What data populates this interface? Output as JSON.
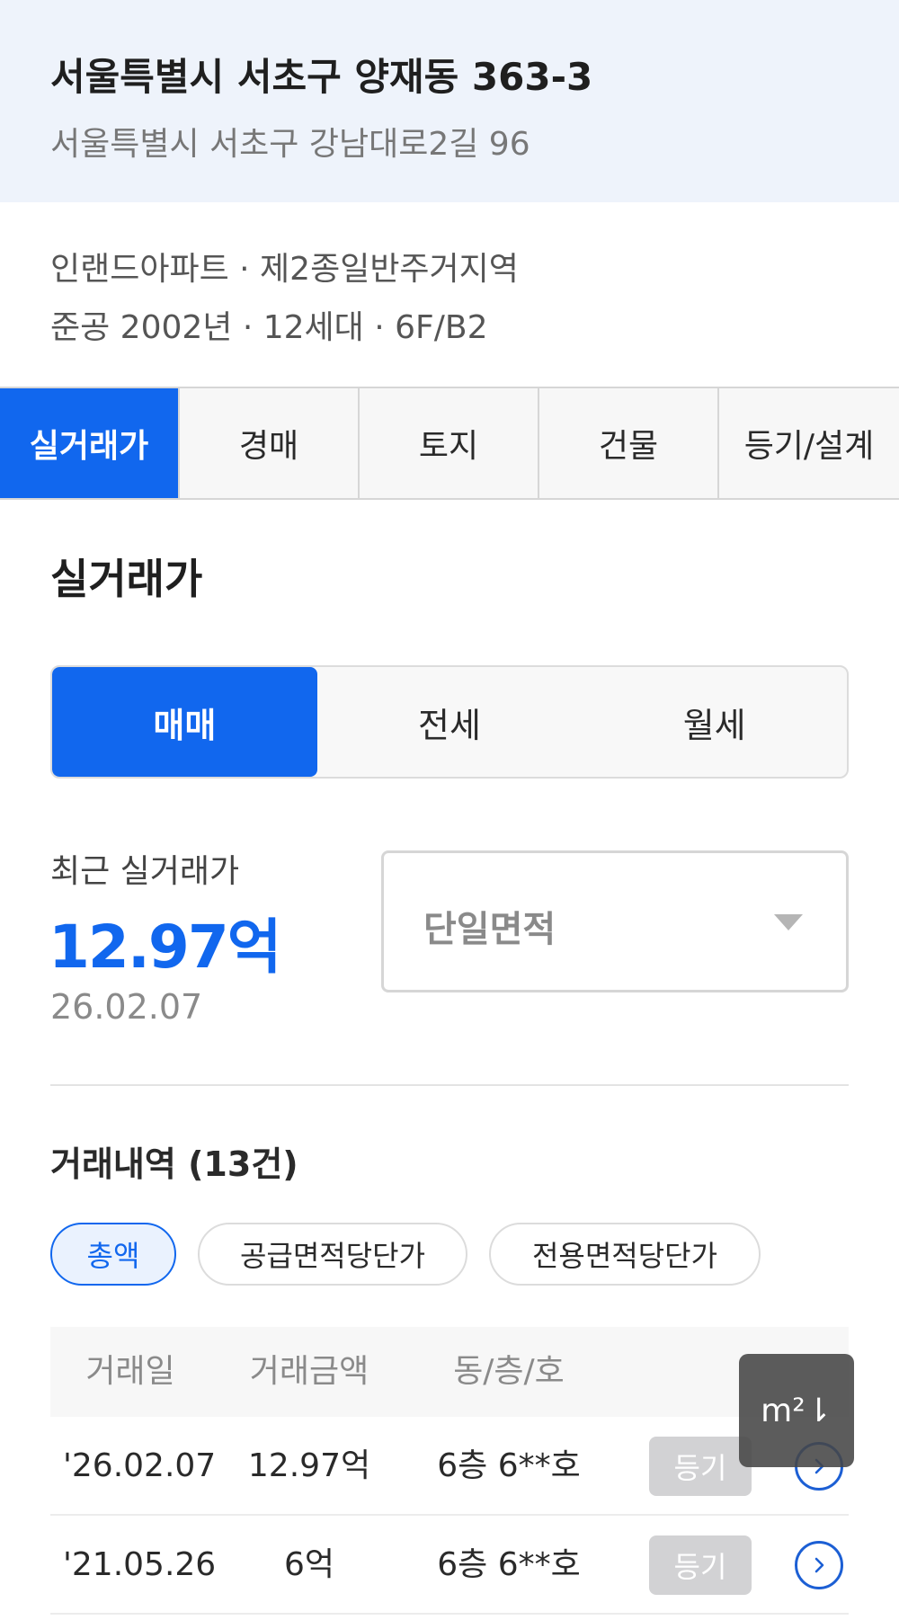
{
  "header": {
    "lot_address": "서울특별시 서초구 양재동 363-3",
    "road_address": "서울특별시 서초구 강남대로2길 96"
  },
  "summary": {
    "line1": "인랜드아파트 · 제2종일반주거지역",
    "line2": "준공 2002년 · 12세대 · 6F/B2"
  },
  "tabs": [
    {
      "label": "실거래가",
      "active": true
    },
    {
      "label": "경매"
    },
    {
      "label": "토지"
    },
    {
      "label": "건물"
    },
    {
      "label": "등기/설계"
    }
  ],
  "section": {
    "title": "실거래가"
  },
  "deal_types": [
    {
      "label": "매매",
      "active": true
    },
    {
      "label": "전세"
    },
    {
      "label": "월세"
    }
  ],
  "recent": {
    "label": "최근 실거래가",
    "price": "12.97억",
    "date": "26.02.07"
  },
  "area_select": {
    "value": "단일면적",
    "icon": "chevron-down-icon"
  },
  "history": {
    "title": "거래내역 (13건)",
    "chips": [
      {
        "label": "총액",
        "active": true
      },
      {
        "label": "공급면적당단가"
      },
      {
        "label": "전용면적당단가"
      }
    ],
    "columns": [
      "거래일",
      "거래금액",
      "동/층/호"
    ],
    "rows": [
      {
        "date": "'26.02.07",
        "amount": "12.97억",
        "unit": "6층 6**호",
        "register": "등기"
      },
      {
        "date": "'21.05.26",
        "amount": "6억",
        "unit": "6층 6**호",
        "register": "등기"
      }
    ]
  },
  "unit_toggle": {
    "label": "m²⇂"
  },
  "colors": {
    "accent": "#1167ee",
    "header_bg": "#eef3fb",
    "price": "#1167ee"
  }
}
